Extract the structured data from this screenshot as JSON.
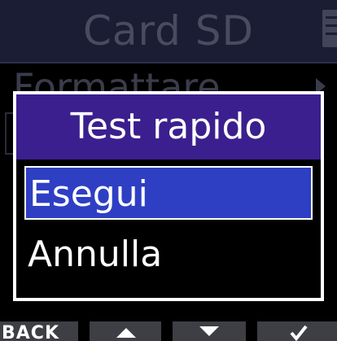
{
  "header": {
    "title": "Card SD",
    "battery_icon": "battery-icon"
  },
  "background_menu": {
    "item_label": "Formattare",
    "arrow_icon": "chevron-right-icon"
  },
  "dialog": {
    "title": "Test rapido",
    "options": [
      {
        "label": "Esegui",
        "selected": true
      },
      {
        "label": "Annulla",
        "selected": false
      }
    ]
  },
  "softkeys": {
    "back_label": "BACK",
    "up_icon": "arrow-up-icon",
    "down_icon": "arrow-down-icon",
    "ok_icon": "check-icon"
  },
  "colors": {
    "header_bg": "#1a1d33",
    "dialog_title_bg": "#3b1f8e",
    "selected_bg": "#2e3fc4",
    "softkey_bg": "#3d3f45"
  }
}
